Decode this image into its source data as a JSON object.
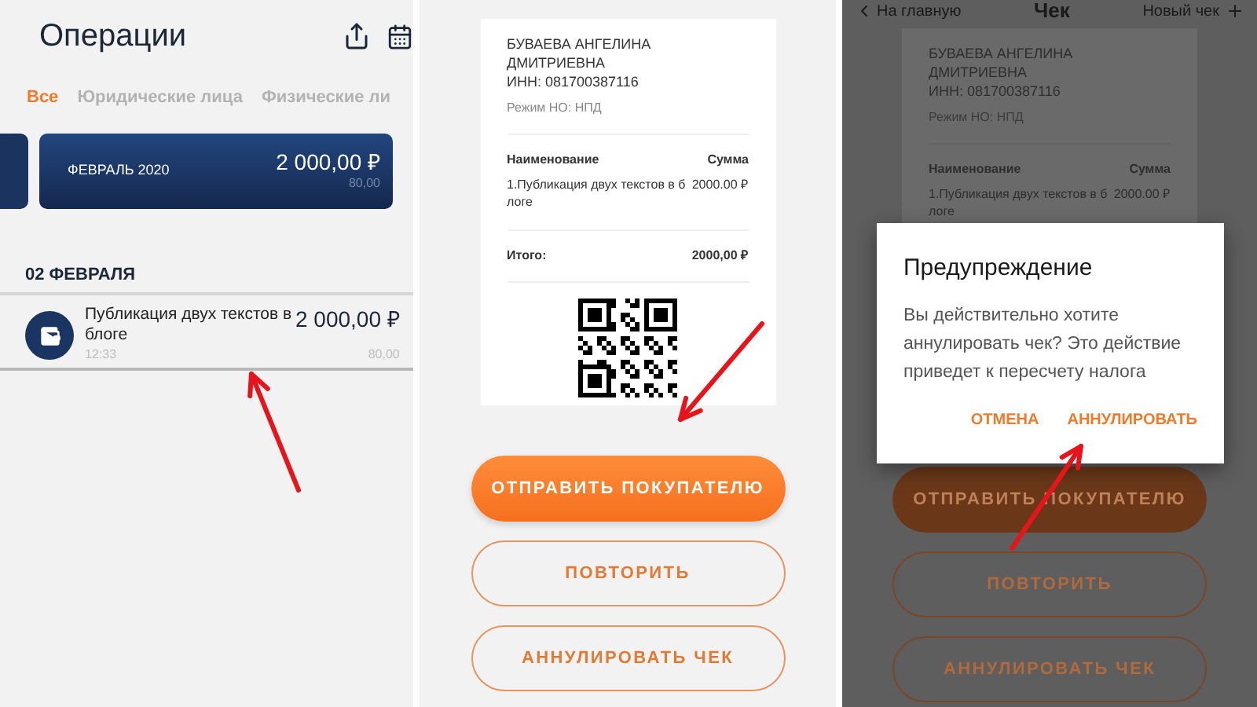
{
  "operations_screen": {
    "title": "Операции",
    "tabs": [
      {
        "label": "Все",
        "selected": true
      },
      {
        "label": "Юридические лица",
        "selected": false
      },
      {
        "label": "Физические ли",
        "selected": false
      }
    ],
    "month_card": {
      "period": "ФЕВРАЛЬ 2020",
      "amount": "2 000,00 ₽",
      "tax": "80,00"
    },
    "date_header": "02 ФЕВРАЛЯ",
    "operations": [
      {
        "title": "Публикация двух текстов в блоге",
        "time": "12:33",
        "amount": "2 000,00 ₽",
        "tax": "80,00"
      }
    ]
  },
  "receipt_screen": {
    "dimmed": false,
    "receipt": {
      "name": "БУВАЕВА АНГЕЛИНА ДМИТРИЕВНА",
      "inn": "ИНН: 081700387116",
      "tax_mode": "Режим НО: НПД",
      "columns": [
        "Наименование",
        "Сумма"
      ],
      "items": [
        {
          "name": "1.Публикация двух текстов в блоге",
          "amount": "2000.00 ₽"
        }
      ],
      "total_label": "Итого:",
      "total": "2000,00 ₽",
      "qr": true
    },
    "buttons": [
      {
        "label": "ОТПРАВИТЬ ПОКУПАТЕЛЮ",
        "kind": "filled"
      },
      {
        "label": "ПОВТОРИТЬ",
        "kind": "outline"
      },
      {
        "label": "АННУЛИРОВАТЬ ЧЕК",
        "kind": "outline"
      }
    ]
  },
  "cancel_screen": {
    "dimmed": true,
    "header": {
      "back": "На главную",
      "title": "Чек",
      "action": "Новый чек"
    },
    "receipt": {
      "name": "БУВАЕВА АНГЕЛИНА ДМИТРИЕВНА",
      "inn": "ИНН: 081700387116",
      "tax_mode": "Режим НО: НПД",
      "columns": [
        "Наименование",
        "Сумма"
      ],
      "items": [
        {
          "name": "1.Публикация двух текстов в блоге",
          "amount": "2000.00 ₽"
        }
      ]
    },
    "dialog": {
      "title": "Предупреждение",
      "message": "Вы действительно хотите аннулировать чек? Это действие приведет к пересчету налога",
      "actions": [
        "ОТМЕНА",
        "АННУЛИРОВАТЬ"
      ]
    },
    "buttons": [
      {
        "label": "ОТПРАВИТЬ ПОКУПАТЕЛЮ",
        "kind": "filled"
      },
      {
        "label": "ПОВТОРИТЬ",
        "kind": "outline"
      },
      {
        "label": "АННУЛИРОВАТЬ ЧЕК",
        "kind": "outline"
      }
    ]
  }
}
